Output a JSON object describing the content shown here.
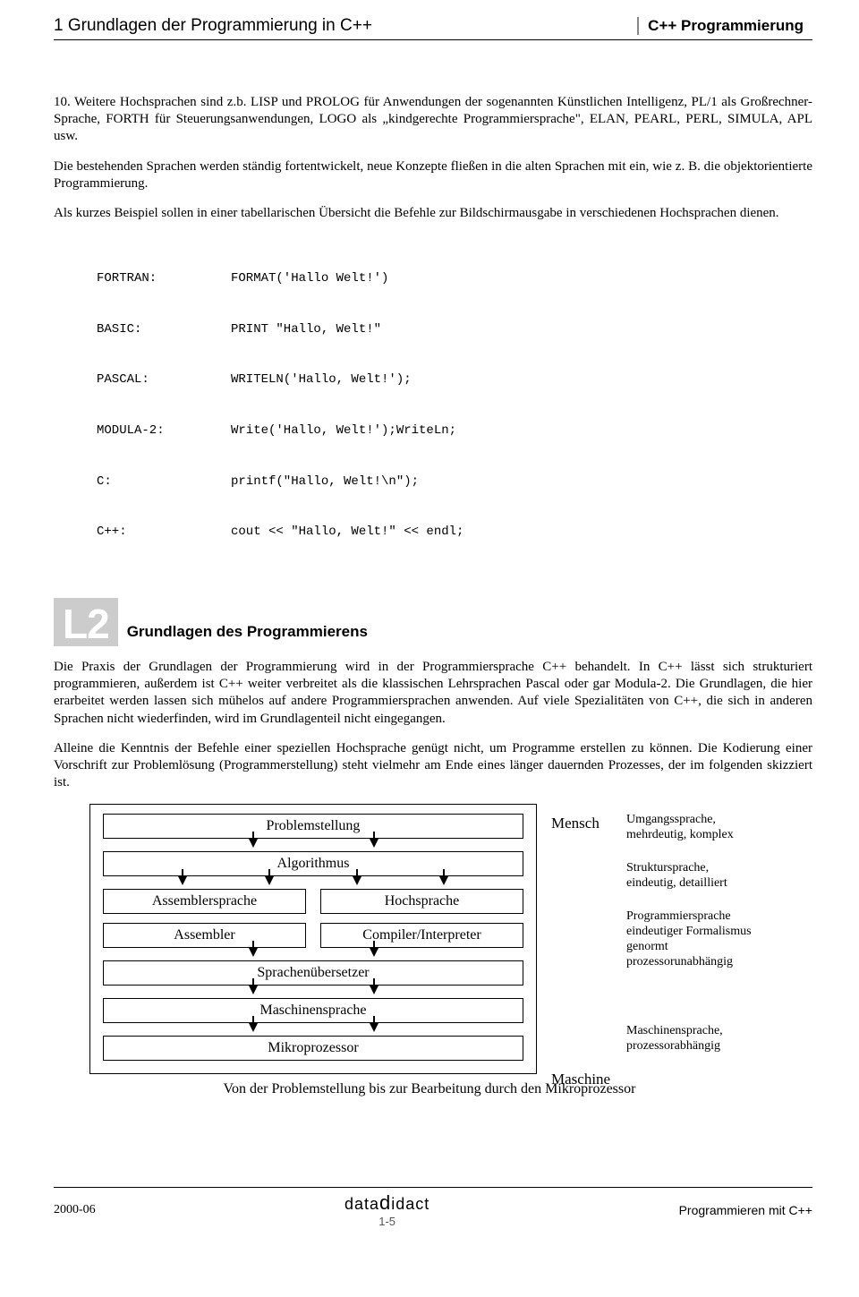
{
  "header": {
    "left": "1 Grundlagen der Programmierung in C++",
    "right": "C++ Programmierung"
  },
  "para1": "10. Weitere Hochsprachen sind z.b. LISP und PROLOG für Anwendungen der sogenannten Künstlichen Intelligenz, PL/1 als Großrechner-Sprache, FORTH für Steuerungsanwendungen, LOGO als „kindgerechte Programmiersprache\", ELAN, PEARL, PERL, SIMULA, APL usw.",
  "para2": "Die bestehenden Sprachen werden ständig fortentwickelt, neue Konzepte fließen in die alten Sprachen mit ein, wie z. B. die objektorientierte Programmierung.",
  "para3": "Als kurzes Beispiel sollen in einer tabellarischen Übersicht die Befehle zur Bildschirmausgabe in verschiedenen Hochsprachen dienen.",
  "code": [
    {
      "lang": "FORTRAN:",
      "stmt": "FORMAT('Hallo Welt!')"
    },
    {
      "lang": "BASIC:",
      "stmt": "PRINT \"Hallo, Welt!\""
    },
    {
      "lang": "PASCAL:",
      "stmt": "WRITELN('Hallo, Welt!');"
    },
    {
      "lang": "MODULA-2:",
      "stmt": "Write('Hallo, Welt!');WriteLn;"
    },
    {
      "lang": "C:",
      "stmt": "printf(\"Hallo, Welt!\\n\");"
    },
    {
      "lang": "C++:",
      "stmt": "cout << \"Hallo, Welt!\" << endl;"
    }
  ],
  "section": {
    "badge": "L2",
    "title": "Grundlagen des Programmierens"
  },
  "para4": "Die Praxis der Grundlagen der Programmierung wird in der Programmiersprache C++ behandelt. In C++ lässt sich strukturiert programmieren, außerdem ist C++ weiter verbreitet als die klassischen Lehrsprachen Pascal oder gar Modula-2. Die Grundlagen, die hier erarbeitet werden lassen sich mühelos auf andere Programmiersprachen anwenden. Auf viele Spezialitäten von C++, die sich in anderen Sprachen nicht wiederfinden, wird im Grundlagenteil nicht eingegangen.",
  "para5": "Alleine die Kenntnis der Befehle einer speziellen Hochsprache genügt nicht, um Programme erstellen zu können. Die Kodierung einer Vorschrift zur Problemlösung (Programmerstellung) steht vielmehr am Ende eines länger dauernden Prozesses, der im folgenden skizziert ist.",
  "diagram": {
    "problem": "Problemstellung",
    "algo": "Algorithmus",
    "asm_lang": "Assemblersprache",
    "high_lang": "Hochsprache",
    "assembler": "Assembler",
    "compiler": "Compiler/Interpreter",
    "translator": "Sprachenübersetzer",
    "machine_lang": "Maschinensprache",
    "micro": "Mikroprozessor",
    "mensch": "Mensch",
    "maschine": "Maschine",
    "note_problem": "Umgangssprache,\nmehrdeutig, komplex",
    "note_algo": "Struktursprache,\neindeutig, detailliert",
    "note_lang": "Programmiersprache\neindeutiger Formalismus\ngenormt\nprozessorunabhängig",
    "note_machine": "Maschinensprache,\nprozessorabhängig",
    "caption": "Von der Problemstellung bis zur Bearbeitung durch den Mikroprozessor"
  },
  "footer": {
    "left": "2000-06",
    "brand": "datadidact",
    "page": "1-5",
    "right": "Programmieren mit C++"
  }
}
